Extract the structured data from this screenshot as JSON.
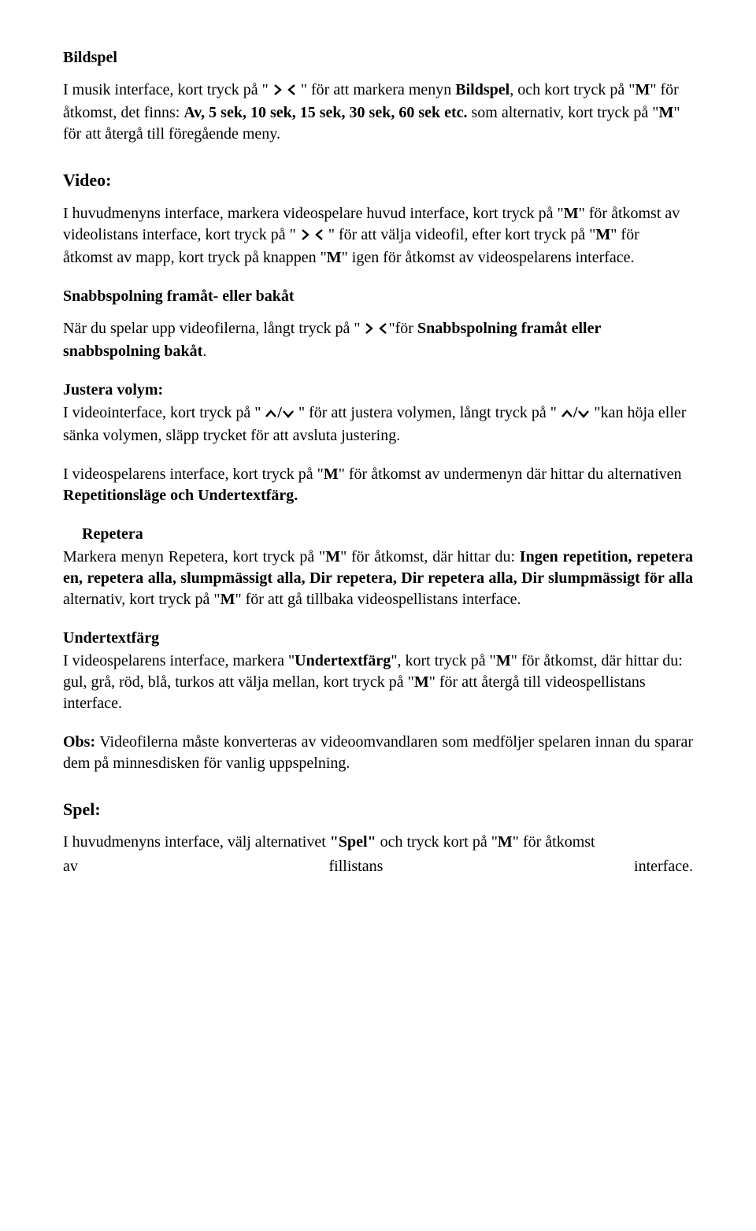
{
  "h1": "Bildspel",
  "p1a": "I musik interface, kort tryck på \"",
  "p1b": "\" för att markera menyn ",
  "p1c": "Bildspel",
  "p1d": ", och kort tryck på \"",
  "p1e": "M",
  "p1f": "\" för åtkomst, det finns: ",
  "p1g": "Av, 5 sek, 10 sek, 15 sek, 30 sek, 60 sek etc.",
  "p1h": " som alternativ, kort tryck på \"",
  "p1i": "M",
  "p1j": "\" för att återgå till föregående meny.",
  "h2": "Video:",
  "p2a": "I huvudmenyns interface, markera videospelare huvud interface, kort tryck på \"",
  "p2b": "M",
  "p2c": "\" för åtkomst av videolistans interface, kort tryck på \"",
  "p2d": "\" för att välja videofil, efter kort tryck på \"",
  "p2e": "M",
  "p2f": "\" för åtkomst av mapp, kort tryck på knappen \"",
  "p2g": "M",
  "p2h": "\" igen för åtkomst av videospelarens interface.",
  "h3": "Snabbspolning framåt- eller bakåt",
  "p3a": "När du spelar upp videofilerna, långt tryck på \"",
  "p3b": "\"för ",
  "p3c": "Snabbspolning framåt eller snabbspolning bakåt",
  "p3d": ".",
  "h4": "Justera volym:",
  "p4a": "I videointerface, kort tryck på \"",
  "p4b": "\" för att justera volymen, långt tryck på \"",
  "p4c": "\"kan höja eller sänka volymen, släpp trycket för att avsluta justering.",
  "p5a": "I videospelarens interface, kort tryck på \"",
  "p5b": "M",
  "p5c": "\" för åtkomst av undermenyn där hittar du alternativen ",
  "p5d": "Repetitionsläge och Undertextfärg.",
  "h5": "Repetera",
  "p6a": "Markera menyn Repetera, kort tryck på \"",
  "p6b": "M",
  "p6c": "\" för åtkomst, där hittar du: ",
  "p6d": "Ingen repetition, repetera en, repetera alla, slumpmässigt alla, Dir repetera, Dir repetera alla, Dir slumpmässigt för alla",
  "p6e": " alternativ, kort tryck på \"",
  "p6f": "M",
  "p6g": "\" för att gå tillbaka videospellistans interface.",
  "h6": "Undertextfärg",
  "p7a": "I videospelarens interface, markera \"",
  "p7b": "Undertextfärg",
  "p7c": "\", kort tryck på \"",
  "p7d": "M",
  "p7e": "\" för åtkomst, där hittar du: gul, grå, röd, blå, turkos att välja mellan, kort tryck på \"",
  "p7f": "M",
  "p7g": "\" för att återgå till videospellistans interface.",
  "p8a": "Obs:",
  "p8b": " Videofilerna måste konverteras av videoomvandlaren som medföljer spelaren innan du sparar dem på minnesdisken för vanlig uppspelning.",
  "h7": "Spel:",
  "p9a": "I huvudmenyns interface, välj alternativet ",
  "p9b": "\"Spel\"",
  "p9c": " och tryck kort på \"",
  "p9d": "M",
  "p9e": "\" för åtkomst",
  "p9f": "av",
  "p9g": "fillistans",
  "p9h": "interface."
}
